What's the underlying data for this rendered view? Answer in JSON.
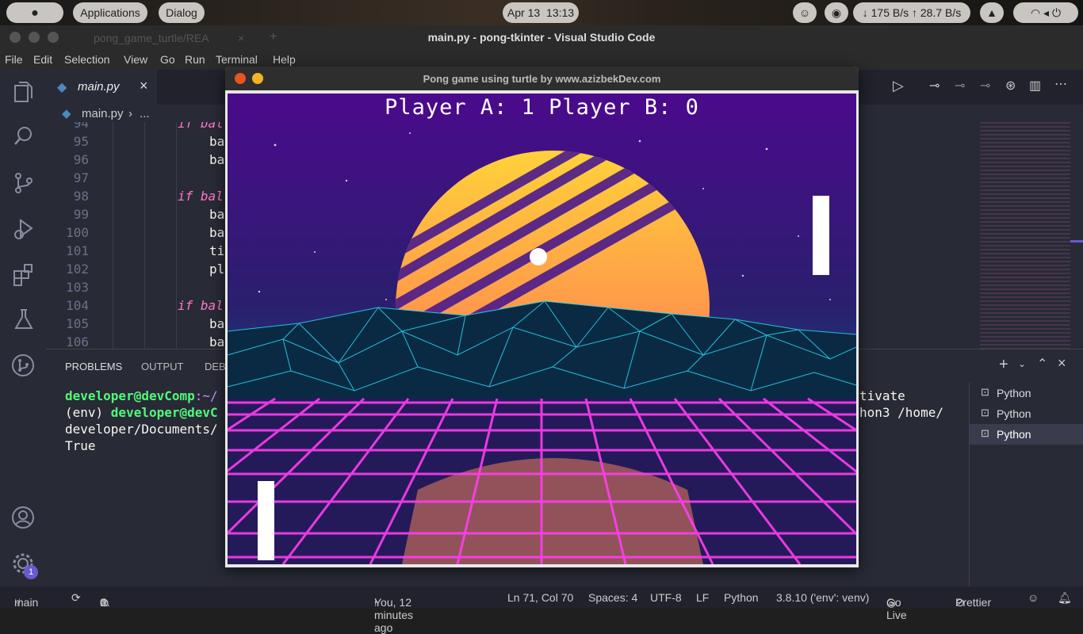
{
  "topbar": {
    "applications": "Applications",
    "dialog": "Dialog",
    "date": "Apr 13",
    "time": "13:13",
    "net_speed": "↓ 175 B/s ↑ 28.7 B/s"
  },
  "vscode": {
    "window_title": "main.py - pong-tkinter - Visual Studio Code",
    "bg_tab": "pong_game_turtle/REA",
    "menu": [
      "File",
      "Edit",
      "Selection",
      "View",
      "Go",
      "Run",
      "Terminal",
      "Help"
    ],
    "active_tab": "main.py",
    "breadcrumb_file": "main.py",
    "breadcrumb_more": "...",
    "code_lines": [
      {
        "num": "94",
        "text": "if bal"
      },
      {
        "num": "95",
        "text": "ba"
      },
      {
        "num": "96",
        "text": "ba"
      },
      {
        "num": "97",
        "text": ""
      },
      {
        "num": "98",
        "text": "if bal"
      },
      {
        "num": "99",
        "text": "ba"
      },
      {
        "num": "100",
        "text": "ba"
      },
      {
        "num": "101",
        "text": "ti"
      },
      {
        "num": "102",
        "text": "pl"
      },
      {
        "num": "103",
        "text": ""
      },
      {
        "num": "104",
        "text": "if bal"
      },
      {
        "num": "105",
        "text": "ba"
      },
      {
        "num": "106",
        "text": "ba"
      }
    ],
    "panel_tabs": [
      "PROBLEMS",
      "OUTPUT",
      "DEB"
    ],
    "terminal": {
      "line1_user": "developer@devComp",
      "line1_rest": ":~/",
      "line1_right": "tivate",
      "line2_env": "(env) ",
      "line2_user": "developer@devC",
      "line2_right": "hon3 /home/",
      "line3": "developer/Documents/",
      "line4": "True"
    },
    "terminal_list": [
      "Python",
      "Python",
      "Python"
    ],
    "status": {
      "branch": "main",
      "errors": "0",
      "warnings": "0",
      "blame": "You, 12 minutes ago",
      "position": "Ln 71, Col 70",
      "spaces": "Spaces: 4",
      "encoding": "UTF-8",
      "eol": "LF",
      "language": "Python",
      "interpreter": "3.8.10 ('env': venv)",
      "golive": "Go Live",
      "prettier": "Prettier"
    },
    "settings_badge": "1"
  },
  "game": {
    "window_title": "Pong game using turtle by www.azizbekDev.com",
    "score_text": "Player A: 1  Player B: 0"
  },
  "colors": {
    "accent_green": "#50fa7b",
    "keyword_pink": "#ff79c6",
    "sky_top": "#4b0a8c",
    "grid_magenta": "#ff3df0"
  }
}
